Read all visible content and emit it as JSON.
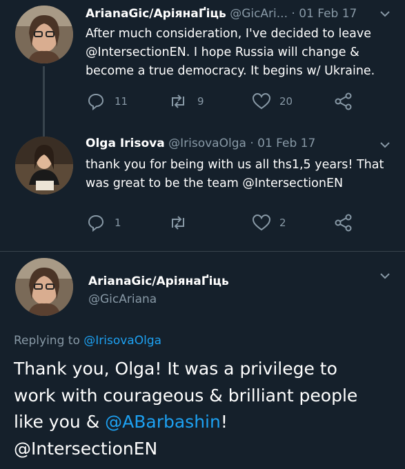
{
  "tweets": [
    {
      "name": "ArianaGic/АріянаҐіць",
      "handle_date": "@GicAri... · 01 Feb 17",
      "lines": [
        "After much consideration, I've decided to leave",
        "@IntersectionEN. I hope Russia will change &",
        "become a true democracy. It begins w/ Ukraine."
      ],
      "replies": "11",
      "retweets": "9",
      "likes": "20"
    },
    {
      "name": "Olga Irisova",
      "handle_date": "@IrisovaOlga · 01 Feb 17",
      "lines": [
        "thank you for being with us all ths1,5 years! That",
        "was great to be the team @IntersectionEN"
      ],
      "replies": "1",
      "retweets": "",
      "likes": "2"
    }
  ],
  "main": {
    "name": "ArianaGic/АріянаҐіць",
    "handle": "@GicAriana",
    "replying_prefix": "Replying to ",
    "replying_to": "@IrisovaOlga",
    "text_1": "Thank you, Olga! It was a privilege to",
    "text_2": "work with courageous & brilliant people",
    "text_3_a": "like you & ",
    "text_3_mention": "@ABarbashin",
    "text_3_b": "!",
    "text_4": "@IntersectionEN"
  },
  "colors": {
    "background": "#15202b",
    "secondary_text": "#8899a6",
    "link": "#1da1f2"
  }
}
